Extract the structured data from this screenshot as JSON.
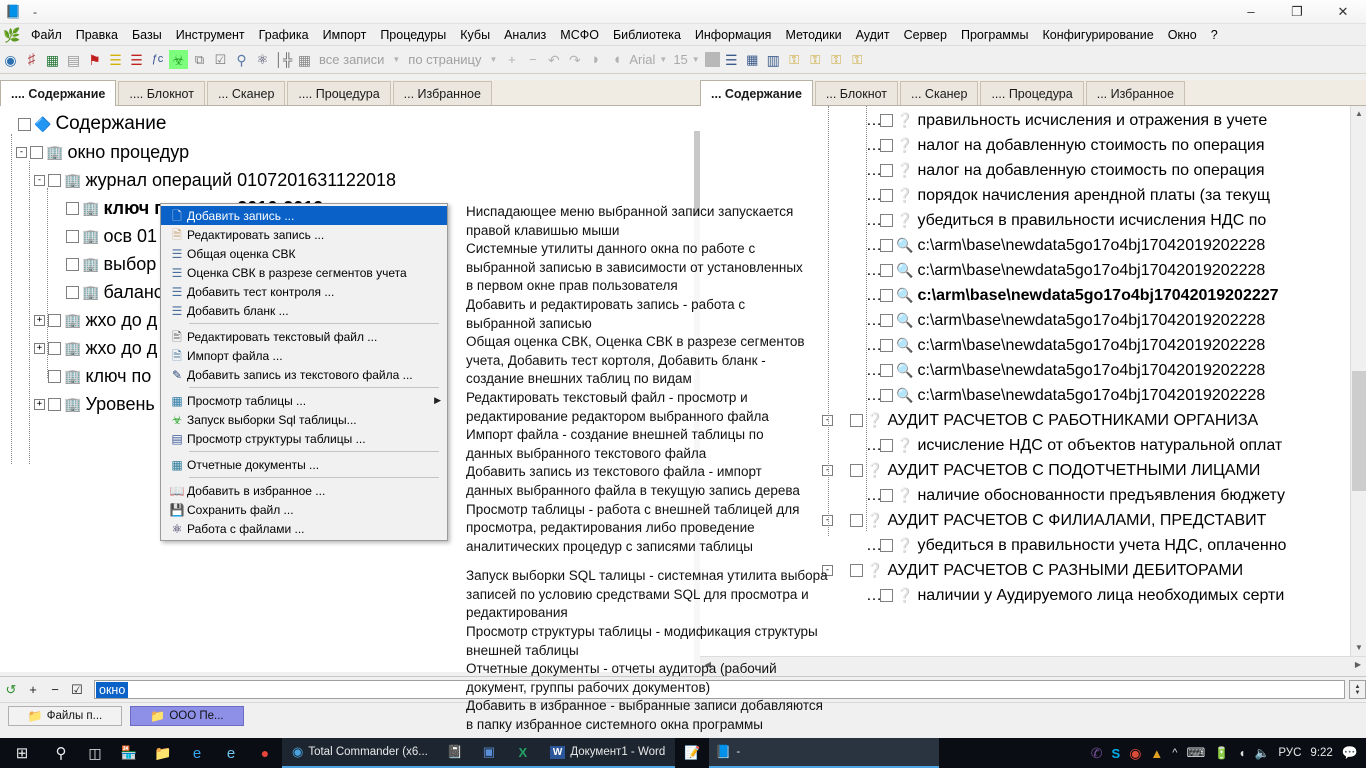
{
  "window": {
    "title": "-",
    "icon": "book-icon",
    "minimize": "–",
    "maximize": "❐",
    "close": "✕"
  },
  "menubar": {
    "items": [
      {
        "label": "Файл"
      },
      {
        "label": "Правка"
      },
      {
        "label": "Базы"
      },
      {
        "label": "Инструмент"
      },
      {
        "label": "Графика"
      },
      {
        "label": "Импорт"
      },
      {
        "label": "Процедуры"
      },
      {
        "label": "Кубы"
      },
      {
        "label": "Анализ"
      },
      {
        "label": "МСФО"
      },
      {
        "label": "Библиотека"
      },
      {
        "label": "Информация"
      },
      {
        "label": "Методики"
      },
      {
        "label": "Аудит"
      },
      {
        "label": "Сервер"
      },
      {
        "label": "Программы"
      },
      {
        "label": "Конфигурирование"
      },
      {
        "label": "Окно"
      },
      {
        "label": "?"
      }
    ]
  },
  "toolbar": {
    "icons_left": [
      {
        "name": "globe-icon",
        "glyph": "◕",
        "color": "#2a6fb0"
      },
      {
        "name": "grid-red-icon",
        "glyph": "⌗",
        "color": "#b04a4a"
      },
      {
        "name": "grid-green-icon",
        "glyph": "▒",
        "color": "#2a7a3a"
      },
      {
        "name": "table-gray-icon",
        "glyph": "▤",
        "color": "#8a8a8a"
      },
      {
        "name": "flag-red-icon",
        "glyph": "⚑",
        "color": "#c02020"
      },
      {
        "name": "sort-yellow-icon",
        "glyph": "≡",
        "color": "#d4b106"
      },
      {
        "name": "sort-red-icon",
        "glyph": "≡",
        "color": "#c02020"
      },
      {
        "name": "formula-icon",
        "glyph": "ƒc",
        "color": "#304f8f"
      },
      {
        "name": "bug-green-icon",
        "glyph": "☸",
        "color": "#2fa82f"
      },
      {
        "name": "copy-list-icon",
        "glyph": "⧉",
        "color": "#7a7a7a"
      },
      {
        "name": "check-box-icon",
        "glyph": "☑",
        "color": "#7a7a7a"
      },
      {
        "name": "search-icon",
        "glyph": "⌕",
        "color": "#5a7ba8"
      },
      {
        "name": "binoculars-icon",
        "glyph": "♟♟",
        "color": "#3a3a5a"
      },
      {
        "name": "hierarchy-icon",
        "glyph": "⑂",
        "color": "#6a6a6a"
      },
      {
        "name": "report-icon",
        "glyph": "▦",
        "color": "#8a8a8a"
      }
    ],
    "all_records_label": "все записи",
    "per_page_label": "по страницу",
    "icons_mid": [
      {
        "name": "plus-icon",
        "glyph": "＋",
        "color": "#b4b4b4"
      },
      {
        "name": "minus-icon",
        "glyph": "－",
        "color": "#b4b4b4"
      },
      {
        "name": "undo-icon",
        "glyph": "↶",
        "color": "#b4b4b4"
      },
      {
        "name": "redo-icon",
        "glyph": "↷",
        "color": "#b4b4b4"
      },
      {
        "name": "page-icon",
        "glyph": "◗",
        "color": "#b0b0b0"
      },
      {
        "name": "page2-icon",
        "glyph": "◖",
        "color": "#b0b0b0"
      }
    ],
    "font_name": "Arial",
    "font_size": "15",
    "icons_right": [
      {
        "name": "lines-view-icon",
        "glyph": "☰",
        "color": "#3a5a8a"
      },
      {
        "name": "thumbnails-view-icon",
        "glyph": "▒",
        "color": "#3a5a8a"
      },
      {
        "name": "columns-view-icon",
        "glyph": "▥",
        "color": "#3a5a8a"
      },
      {
        "name": "key1-icon",
        "glyph": "⚷",
        "color": "#c9a227"
      },
      {
        "name": "key2-icon",
        "glyph": "⚷",
        "color": "#c9a227"
      },
      {
        "name": "key3-icon",
        "glyph": "⚷",
        "color": "#c9a227"
      },
      {
        "name": "key4-icon",
        "glyph": "⚷",
        "color": "#c9a227"
      }
    ]
  },
  "left_panel": {
    "tabs": [
      {
        "label": ".... Содержание",
        "active": true
      },
      {
        "label": ".... Блокнот",
        "active": false
      },
      {
        "label": "... Сканер",
        "active": false
      },
      {
        "label": ".... Процедура",
        "active": false
      },
      {
        "label": "... Избранное",
        "active": false
      }
    ],
    "tree": [
      {
        "level": 0,
        "expander": "",
        "checkbox": true,
        "icon": "globe-icon",
        "label": "Содержание",
        "bold": false
      },
      {
        "level": 1,
        "expander": "-",
        "checkbox": true,
        "icon": "folder-icon",
        "label": "окно процедур",
        "bold": false
      },
      {
        "level": 2,
        "expander": "-",
        "checkbox": true,
        "icon": "folder-icon",
        "label": "журнал операций 0107201631122018",
        "bold": false
      },
      {
        "level": 3,
        "expander": "",
        "checkbox": true,
        "icon": "folder-icon",
        "label": "ключ по риску 2016-2019 год",
        "bold": true
      },
      {
        "level": 3,
        "expander": "",
        "checkbox": true,
        "icon": "folder-icon",
        "label": "осв 01",
        "bold": false
      },
      {
        "level": 3,
        "expander": "",
        "checkbox": true,
        "icon": "folder-icon",
        "label": "выбор",
        "bold": false
      },
      {
        "level": 3,
        "expander": "",
        "checkbox": true,
        "icon": "folder-icon",
        "label": "баланс",
        "bold": false
      },
      {
        "level": 2,
        "expander": "+",
        "checkbox": true,
        "icon": "folder-icon",
        "label": "жхо до д",
        "bold": false
      },
      {
        "level": 2,
        "expander": "+",
        "checkbox": true,
        "icon": "folder-icon",
        "label": "жхо до д",
        "bold": false
      },
      {
        "level": 2,
        "expander": "",
        "checkbox": true,
        "icon": "folder-icon",
        "label": "ключ по",
        "bold": false
      },
      {
        "level": 2,
        "expander": "+",
        "checkbox": true,
        "icon": "folder-icon",
        "label": "Уровень",
        "bold": false
      }
    ]
  },
  "context_menu": {
    "items": [
      {
        "icon": "add-record-icon",
        "glyph": "➕",
        "color": "#2f9e3f",
        "label": "Добавить запись ...",
        "selected": true,
        "arrow": false
      },
      {
        "icon": "edit-record-icon",
        "glyph": "▥",
        "color": "#c8a06a",
        "label": "Редактировать запись ...",
        "selected": false,
        "arrow": false
      },
      {
        "icon": "svk-total-icon",
        "glyph": "⌸",
        "color": "#4a6f9c",
        "label": "Общая оценка СВК",
        "selected": false,
        "arrow": false
      },
      {
        "icon": "svk-segments-icon",
        "glyph": "⌸",
        "color": "#4a6f9c",
        "label": "Оценка СВК в разрезе сегментов учета",
        "selected": false,
        "arrow": false
      },
      {
        "icon": "add-control-test-icon",
        "glyph": "⌸",
        "color": "#4a6f9c",
        "label": "Добавить тест контроля ...",
        "selected": false,
        "arrow": false
      },
      {
        "icon": "add-blank-icon",
        "glyph": "⌸",
        "color": "#4a6f9c",
        "label": "Добавить бланк ...",
        "selected": false,
        "arrow": false
      },
      {
        "separator": true
      },
      {
        "icon": "edit-text-file-icon",
        "glyph": "⌕",
        "color": "#5a5a5a",
        "label": "Редактировать текстовый файл ...",
        "selected": false,
        "arrow": false
      },
      {
        "icon": "import-file-icon",
        "glyph": "⎘",
        "color": "#4a7aa8",
        "label": "Импорт файла ...",
        "selected": false,
        "arrow": false
      },
      {
        "icon": "add-record-from-file-icon",
        "glyph": "✎",
        "color": "#2a4a7a",
        "label": "Добавить запись из текстового файла ...",
        "selected": false,
        "arrow": false
      },
      {
        "separator": true
      },
      {
        "icon": "view-table-icon",
        "glyph": "▦",
        "color": "#2a7aa8",
        "label": "Просмотр таблицы ...",
        "selected": false,
        "arrow": true
      },
      {
        "icon": "sql-query-icon",
        "glyph": "☸",
        "color": "#2fa82f",
        "label": "Запуск выборки Sql таблицы...",
        "selected": false,
        "arrow": false
      },
      {
        "icon": "table-structure-icon",
        "glyph": "▤",
        "color": "#3a5a9a",
        "label": "Просмотр структуры таблицы ...",
        "selected": false,
        "arrow": false
      },
      {
        "separator": true
      },
      {
        "icon": "report-documents-icon",
        "glyph": "▦",
        "color": "#2a7a9a",
        "label": "Отчетные документы ...",
        "selected": false,
        "arrow": false
      },
      {
        "separator": true
      },
      {
        "icon": "add-favorite-icon",
        "glyph": "◖",
        "color": "#3a3a3a",
        "label": "Добавить в избранное ...",
        "selected": false,
        "arrow": false
      },
      {
        "icon": "save-file-icon",
        "glyph": "Ὃe",
        "color": "#2a2a2a",
        "label": "Сохранить файл ...",
        "selected": false,
        "arrow": false
      },
      {
        "icon": "file-work-icon",
        "glyph": "♟♟",
        "color": "#1a1a4a",
        "label": "Работа с файлами ...",
        "selected": false,
        "arrow": false
      }
    ]
  },
  "help_text": {
    "blocks": [
      [
        "Ниспадающее меню выбранной записи запускается",
        "правой клавишью мыши"
      ],
      [
        "Системные утилиты данного окна по работе с",
        "выбранной записью в зависимости от установленных",
        "в первом окне прав пользователя"
      ],
      [
        "Добавить и редактировать запись - работа с",
        "выбранной записью"
      ],
      [
        "Общая оценка СВК, Оценка СВК в разрезе сегментов",
        "учета, Добавить тест кортоля, Добавить бланк -",
        "создание внешних таблиц по видам"
      ],
      [
        "Редактировать текстовый файл - просмотр и",
        "редактирование редактором выбранного файла"
      ],
      [
        "Импорт файла - создание внешней таблицы по",
        "данных выбранного текстового файла"
      ],
      [
        "Добавить запись из текстового файла - импорт",
        "данных выбранного файла в текущую запись дерева"
      ],
      [
        "Просмотр таблицы - работа с внешней таблицей для",
        "просмотра, редактирования либо проведение",
        "аналитических процедур с записями таблицы"
      ]
    ],
    "blocks2": [
      [
        "Запуск выборки SQL талицы - системная утилита выбора",
        "записей по условию средствами SQL для просмотра и",
        "редактирования"
      ],
      [
        "Просмотр структуры таблицы - модификация структуры",
        "внешней таблицы"
      ],
      [
        "Отчетные документы - отчеты аудитора (рабочий",
        "документ, группы рабочих документов)"
      ],
      [
        "Добавить в избранное - выбранные записи добавляются",
        "в папку избранное системного окна программы"
      ]
    ]
  },
  "right_panel": {
    "tabs": [
      {
        "label": "... Содержание",
        "active": true
      },
      {
        "label": "... Блокнот",
        "active": false
      },
      {
        "label": "... Сканер",
        "active": false
      },
      {
        "label": ".... Процедура",
        "active": false
      },
      {
        "label": "... Избранное",
        "active": false
      }
    ],
    "tree": [
      {
        "indent": 3,
        "expander": "",
        "icon": "question-icon",
        "label": "правильность исчисления и отражения в учете",
        "bold": false
      },
      {
        "indent": 3,
        "expander": "",
        "icon": "question-icon",
        "label": "налог на добавленную стоимость по операция",
        "bold": false
      },
      {
        "indent": 3,
        "expander": "",
        "icon": "question-icon",
        "label": "налог на добавленную стоимость по операция",
        "bold": false
      },
      {
        "indent": 3,
        "expander": "",
        "icon": "question-icon",
        "label": "порядок начисления арендной платы (за текущ",
        "bold": false
      },
      {
        "indent": 3,
        "expander": "",
        "icon": "question-icon",
        "label": "убедиться в правильности исчисления НДС по",
        "bold": false
      },
      {
        "indent": 3,
        "expander": "",
        "icon": "magnifier-icon",
        "label": "c:\\arm\\base\\newdata5go17o4bj17042019202228",
        "bold": false
      },
      {
        "indent": 3,
        "expander": "",
        "icon": "magnifier-icon",
        "label": "c:\\arm\\base\\newdata5go17o4bj17042019202228",
        "bold": false
      },
      {
        "indent": 3,
        "expander": "",
        "icon": "magnifier-icon",
        "label": "c:\\arm\\base\\newdata5go17o4bj17042019202227",
        "bold": true
      },
      {
        "indent": 3,
        "expander": "",
        "icon": "magnifier-icon",
        "label": "c:\\arm\\base\\newdata5go17o4bj17042019202228",
        "bold": false
      },
      {
        "indent": 3,
        "expander": "",
        "icon": "magnifier-icon",
        "label": "c:\\arm\\base\\newdata5go17o4bj17042019202228",
        "bold": false
      },
      {
        "indent": 3,
        "expander": "",
        "icon": "magnifier-icon",
        "label": "c:\\arm\\base\\newdata5go17o4bj17042019202228",
        "bold": false
      },
      {
        "indent": 3,
        "expander": "",
        "icon": "magnifier-icon",
        "label": "c:\\arm\\base\\newdata5go17o4bj17042019202228",
        "bold": false
      },
      {
        "indent": 2,
        "expander": "-",
        "icon": "question-icon",
        "label": "АУДИТ РАСЧЕТОВ С РАБОТНИКАМИ ОРГАНИЗА",
        "bold": false
      },
      {
        "indent": 3,
        "expander": "",
        "icon": "question-icon",
        "label": "исчисление НДС от объектов натуральной оплат",
        "bold": false
      },
      {
        "indent": 2,
        "expander": "-",
        "icon": "question-icon",
        "label": "АУДИТ РАСЧЕТОВ С ПОДОТЧЕТНЫМИ ЛИЦАМИ",
        "bold": false
      },
      {
        "indent": 3,
        "expander": "",
        "icon": "question-icon",
        "label": "наличие обоснованности предъявления бюджету",
        "bold": false
      },
      {
        "indent": 2,
        "expander": "-",
        "icon": "question-icon",
        "label": "АУДИТ РАСЧЕТОВ С ФИЛИАЛАМИ, ПРЕДСТАВИТ",
        "bold": false
      },
      {
        "indent": 3,
        "expander": "",
        "icon": "question-icon",
        "label": "убедиться в правильности учета НДС, оплаченно",
        "bold": false
      },
      {
        "indent": 2,
        "expander": "-",
        "icon": "question-icon",
        "label": "АУДИТ РАСЧЕТОВ   С РАЗНЫМИ ДЕБИТОРАМИ",
        "bold": false
      },
      {
        "indent": 3,
        "expander": "",
        "icon": "question-icon",
        "label": "наличии у Аудируемого лица необходимых серти",
        "bold": false
      }
    ]
  },
  "bottom_bar": {
    "icons": [
      {
        "name": "refresh-icon",
        "glyph": "↻",
        "color": "#2f8f2f"
      },
      {
        "name": "plus-icon",
        "glyph": "＋",
        "color": "#222"
      },
      {
        "name": "minus-icon",
        "glyph": "−",
        "color": "#222"
      },
      {
        "name": "check-icon",
        "glyph": "☑",
        "color": "#222"
      }
    ],
    "field_value": "окно"
  },
  "mdi_bar": {
    "buttons": [
      {
        "label": "Файлы п...",
        "active": false,
        "icon": "folder-icon"
      },
      {
        "label": "ООО Пе...",
        "active": true,
        "icon": "folder-icon"
      }
    ]
  },
  "taskbar": {
    "start": {
      "name": "start-button",
      "glyph": "⊞"
    },
    "items": [
      {
        "name": "search-icon",
        "glyph": "⌕",
        "label": ""
      },
      {
        "name": "task-view-icon",
        "glyph": "⌸",
        "label": ""
      },
      {
        "name": "store-icon",
        "glyph": "Ὤd",
        "label": ""
      },
      {
        "name": "file-explorer-icon",
        "glyph": "Ὄ1",
        "label": ""
      },
      {
        "name": "edge-icon",
        "glyph": "e",
        "label": ""
      },
      {
        "name": "internet-explorer-icon",
        "glyph": "e",
        "label": ""
      },
      {
        "name": "opera-icon",
        "glyph": "●",
        "label": ""
      },
      {
        "name": "total-commander-task",
        "glyph": "◔",
        "label": "Total Commander (x6..."
      },
      {
        "name": "notepad-task",
        "glyph": "Ὅ3",
        "label": ""
      },
      {
        "name": "app-blue-task",
        "glyph": "▣",
        "label": ""
      },
      {
        "name": "excel-task",
        "glyph": "X",
        "label": ""
      },
      {
        "name": "word-task",
        "glyph": "W",
        "label": "Документ1 - Word"
      },
      {
        "name": "notes-task",
        "glyph": "Ὅd",
        "label": ""
      },
      {
        "name": "audit-app-task",
        "glyph": "Ὅ8",
        "label": "-"
      }
    ],
    "tray": [
      {
        "name": "show-hidden-icons",
        "glyph": "∧"
      },
      {
        "name": "keyboard-icon",
        "glyph": "⌨"
      },
      {
        "name": "battery-icon",
        "glyph": "ὐb"
      },
      {
        "name": "wifi-icon",
        "glyph": "◠"
      },
      {
        "name": "volume-icon",
        "glyph": "ὐa"
      }
    ],
    "tray_apps": [
      {
        "name": "viber-icon",
        "glyph": "✆",
        "color": "#7b519d"
      },
      {
        "name": "skype-icon",
        "glyph": "S",
        "color": "#00aff0"
      },
      {
        "name": "chrome-icon",
        "glyph": "◎",
        "color": "#dd4b39"
      },
      {
        "name": "utorrent-icon",
        "glyph": "▲",
        "color": "#e0a020"
      }
    ],
    "language": "РУС",
    "clock": "9:22",
    "notification": {
      "name": "action-center-icon",
      "glyph": "▭"
    }
  }
}
